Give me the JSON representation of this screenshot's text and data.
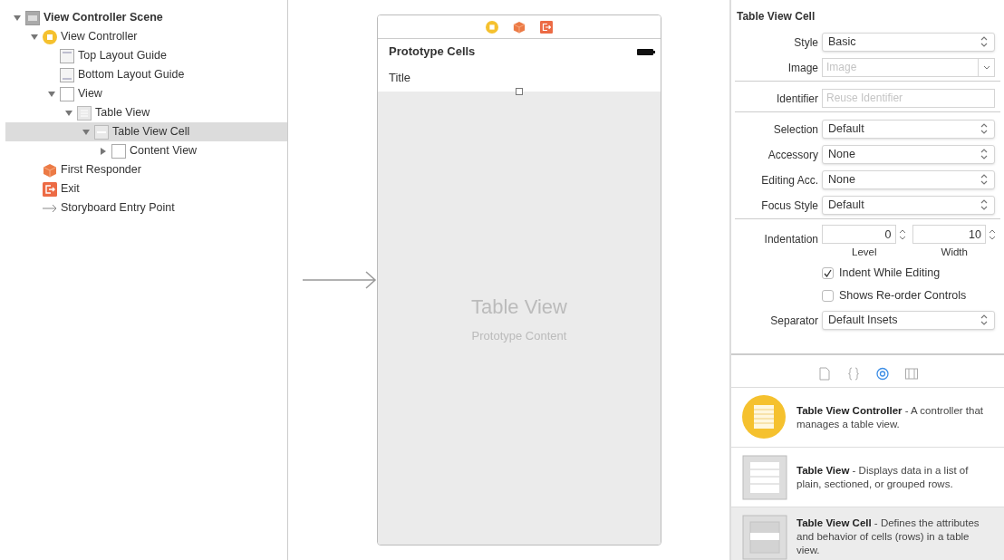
{
  "outline": [
    {
      "label": "View Controller Scene",
      "kind": "scene",
      "bold": true,
      "expanded": true,
      "selected": false,
      "children": [
        {
          "label": "View Controller",
          "kind": "controller",
          "bold": false,
          "expanded": true,
          "selected": false,
          "children": [
            {
              "label": "Top Layout Guide",
              "kind": "top-guide",
              "bold": false,
              "selected": false
            },
            {
              "label": "Bottom Layout Guide",
              "kind": "bottom-guide",
              "bold": false,
              "selected": false
            },
            {
              "label": "View",
              "kind": "view",
              "bold": false,
              "expanded": true,
              "selected": false,
              "children": [
                {
                  "label": "Table View",
                  "kind": "table",
                  "bold": false,
                  "expanded": true,
                  "selected": false,
                  "children": [
                    {
                      "label": "Table View Cell",
                      "kind": "cell",
                      "bold": false,
                      "expanded": true,
                      "selected": true,
                      "children": [
                        {
                          "label": "Content View",
                          "kind": "view",
                          "bold": false,
                          "expanded": false,
                          "selected": false
                        }
                      ]
                    }
                  ]
                }
              ]
            }
          ]
        },
        {
          "label": "First Responder",
          "kind": "responder",
          "bold": false,
          "selected": false
        },
        {
          "label": "Exit",
          "kind": "exit",
          "bold": false,
          "selected": false
        },
        {
          "label": "Storyboard Entry Point",
          "kind": "entry",
          "bold": false,
          "selected": false
        }
      ]
    }
  ],
  "scene": {
    "dock": [
      {
        "kind": "controller"
      },
      {
        "kind": "responder"
      },
      {
        "kind": "exit"
      }
    ],
    "header": "Prototype Cells",
    "cell_title": "Title",
    "placeholder_title": "Table View",
    "placeholder_subtitle": "Prototype Content"
  },
  "inspector": {
    "title": "Table View Cell",
    "groups": [
      [
        {
          "kind": "popup",
          "label": "Style",
          "value": "Basic"
        },
        {
          "kind": "combo",
          "label": "Image",
          "placeholder": "Image"
        }
      ],
      [
        {
          "kind": "field",
          "label": "Identifier",
          "placeholder": "Reuse Identifier"
        }
      ],
      [
        {
          "kind": "popup",
          "label": "Selection",
          "value": "Default"
        },
        {
          "kind": "popup",
          "label": "Accessory",
          "value": "None"
        },
        {
          "kind": "popup",
          "label": "Editing Acc.",
          "value": "None"
        },
        {
          "kind": "popup",
          "label": "Focus Style",
          "value": "Default"
        }
      ],
      [
        {
          "kind": "steppers",
          "label": "Indentation",
          "fields": [
            {
              "value": "0",
              "caption": "Level"
            },
            {
              "value": "10",
              "caption": "Width"
            }
          ]
        },
        {
          "kind": "checkbox",
          "label": "Indent While Editing",
          "checked": true
        },
        {
          "kind": "checkbox",
          "label": "Shows Re-order Controls",
          "checked": false
        },
        {
          "kind": "popup",
          "label": "Separator",
          "value": "Default Insets"
        }
      ]
    ]
  },
  "library": {
    "tabs": [
      {
        "kind": "file",
        "selected": false
      },
      {
        "kind": "code",
        "selected": false
      },
      {
        "kind": "object",
        "selected": true
      },
      {
        "kind": "media",
        "selected": false
      }
    ],
    "items": [
      {
        "kind": "controller",
        "text": "**Table View Controller** - A controller that manages a table view.",
        "selected": false
      },
      {
        "kind": "table",
        "text": "**Table View** - Displays data in a list of plain, sectioned, or grouped rows.",
        "selected": false
      },
      {
        "kind": "cell",
        "text": "**Table View Cell** - Defines the attributes and behavior of cells (rows) in a table view.",
        "selected": true
      }
    ]
  }
}
